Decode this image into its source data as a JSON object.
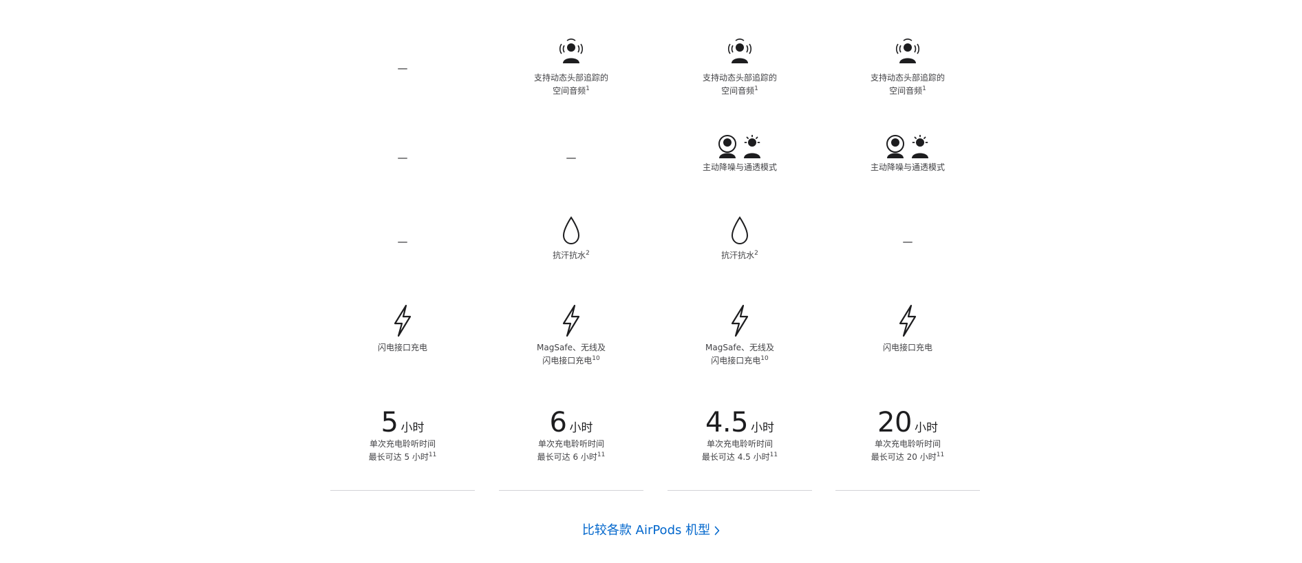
{
  "feature_rows": {
    "spatial_audio": {
      "icon": "head-tracking-icon",
      "caption_line1": "支持动态头部追踪的",
      "caption_line2": "空间音频",
      "footnote": "1",
      "dash": "—"
    },
    "anc": {
      "icon": "noise-cancellation-transparency-icon",
      "caption": "主动降噪与通透模式",
      "dash": "—"
    },
    "water": {
      "icon": "water-drop-icon",
      "caption": "抗汗抗水",
      "footnote": "2",
      "dash": "—"
    },
    "charging": {
      "icon": "lightning-bolt-icon",
      "lightning_caption": "闪电接口充电",
      "magsafe_line1": "MagSafe、无线及",
      "magsafe_line2": "闪电接口充电",
      "magsafe_footnote": "10"
    },
    "battery": {
      "unit": "小时",
      "caption_line1": "单次充电聆听时间",
      "caption_prefix": "最长可达",
      "footnote": "11"
    }
  },
  "columns": [
    {
      "hours": "5",
      "hours_caption": "5 小时"
    },
    {
      "hours": "6",
      "hours_caption": "6 小时"
    },
    {
      "hours": "4.5",
      "hours_caption": "4.5 小时"
    },
    {
      "hours": "20",
      "hours_caption": "20 小时"
    }
  ],
  "compare_link": {
    "label": "比较各款 AirPods 机型",
    "chevron_icon": "chevron-right-icon",
    "color": "#0066cc"
  }
}
